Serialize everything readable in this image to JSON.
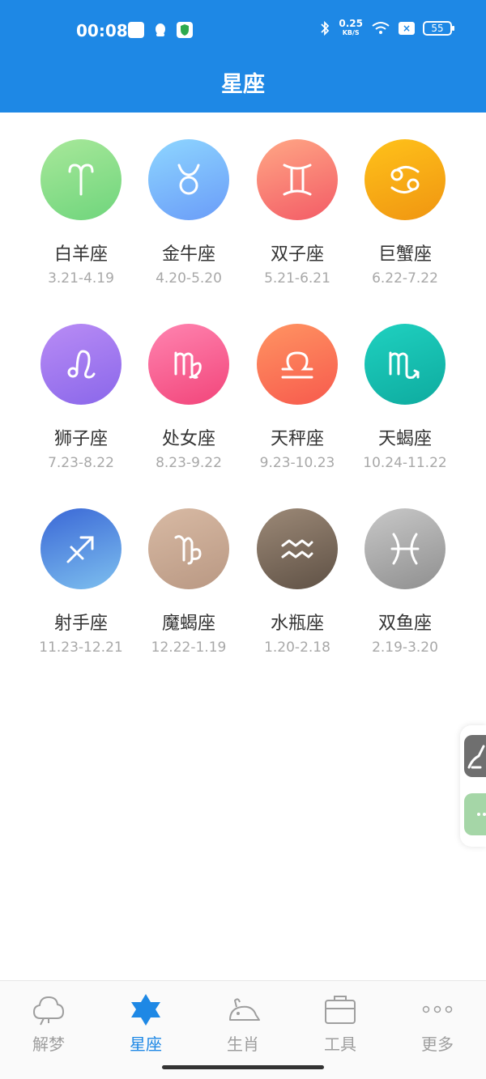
{
  "status_bar": {
    "time": "00:08",
    "net_speed_value": "0.25",
    "net_speed_unit": "KB/S",
    "battery": "55"
  },
  "header": {
    "title": "星座"
  },
  "signs": [
    {
      "name": "白羊座",
      "date": "3.21-4.19",
      "icon": "aries-icon",
      "colors": [
        "#a8e89a",
        "#6fd57c"
      ]
    },
    {
      "name": "金牛座",
      "date": "4.20-5.20",
      "icon": "taurus-icon",
      "colors": [
        "#8ed6ff",
        "#6a9cf8"
      ]
    },
    {
      "name": "双子座",
      "date": "5.21-6.21",
      "icon": "gemini-icon",
      "colors": [
        "#ffa785",
        "#f35b66"
      ]
    },
    {
      "name": "巨蟹座",
      "date": "6.22-7.22",
      "icon": "cancer-icon",
      "colors": [
        "#ffc21a",
        "#f09511"
      ]
    },
    {
      "name": "狮子座",
      "date": "7.23-8.22",
      "icon": "leo-icon",
      "colors": [
        "#b98cf5",
        "#8a67ea"
      ]
    },
    {
      "name": "处女座",
      "date": "8.23-9.22",
      "icon": "virgo-icon",
      "colors": [
        "#ff84b0",
        "#f2457a"
      ]
    },
    {
      "name": "天秤座",
      "date": "9.23-10.23",
      "icon": "libra-icon",
      "colors": [
        "#ff9462",
        "#f75a4d"
      ]
    },
    {
      "name": "天蝎座",
      "date": "10.24-11.22",
      "icon": "scorpio-icon",
      "colors": [
        "#1fd1c0",
        "#0eab9f"
      ]
    },
    {
      "name": "射手座",
      "date": "11.23-12.21",
      "icon": "sagittarius-icon",
      "colors": [
        "#3a67d6",
        "#7ec0ef"
      ]
    },
    {
      "name": "魔蝎座",
      "date": "12.22-1.19",
      "icon": "capricorn-icon",
      "colors": [
        "#d8baa4",
        "#b99883"
      ]
    },
    {
      "name": "水瓶座",
      "date": "1.20-2.18",
      "icon": "aquarius-icon",
      "colors": [
        "#9c8977",
        "#5f5145"
      ]
    },
    {
      "name": "双鱼座",
      "date": "2.19-3.20",
      "icon": "pisces-icon",
      "colors": [
        "#c8c8c8",
        "#8f8f8f"
      ]
    }
  ],
  "tabs": [
    {
      "label": "解梦",
      "icon": "cloud-icon",
      "active": false
    },
    {
      "label": "星座",
      "icon": "star-icon",
      "active": true
    },
    {
      "label": "生肖",
      "icon": "mouse-icon",
      "active": false
    },
    {
      "label": "工具",
      "icon": "toolbox-icon",
      "active": false
    },
    {
      "label": "更多",
      "icon": "more-dots-icon",
      "active": false
    }
  ],
  "colors": {
    "primary": "#1e88e5",
    "inactive": "#9e9e9e"
  }
}
